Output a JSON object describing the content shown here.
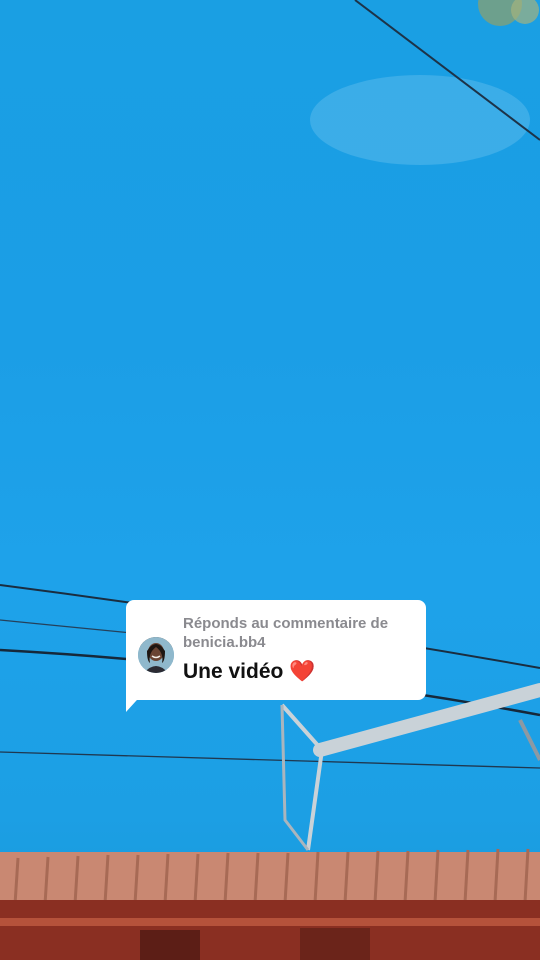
{
  "reply_sticker": {
    "label_prefix": "Réponds au commentaire de",
    "username": "benicia.bb4",
    "comment_text": "Une vidéo",
    "comment_emoji": "❤️"
  },
  "icons": {
    "avatar": "user-avatar-photo",
    "emoji": "red-heart"
  },
  "colors": {
    "sky": "#1ea2ea",
    "card": "#ffffff",
    "label": "#8a8a8f",
    "text": "#111111",
    "heart": "#e1283a"
  }
}
